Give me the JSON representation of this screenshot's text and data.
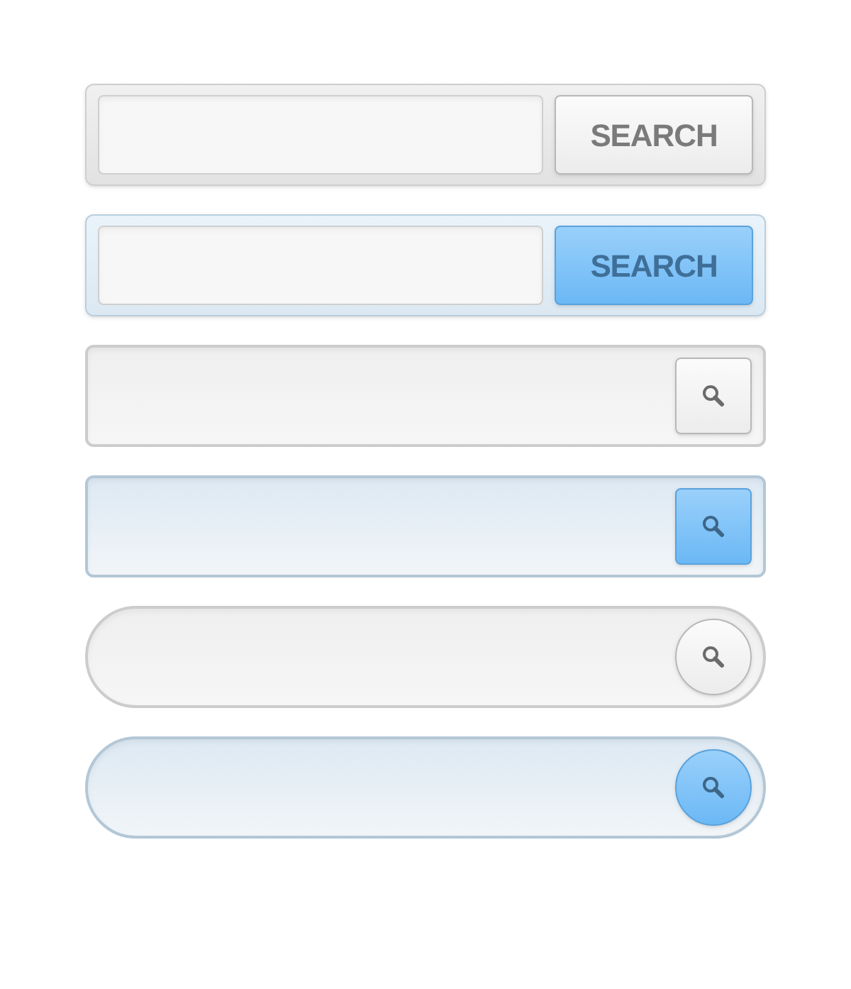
{
  "search_bars": [
    {
      "kind": "text_button",
      "accent": false,
      "button_label": "SEARCH"
    },
    {
      "kind": "text_button",
      "accent": true,
      "button_label": "SEARCH"
    },
    {
      "kind": "icon_button",
      "accent": false
    },
    {
      "kind": "icon_button",
      "accent": true
    },
    {
      "kind": "round",
      "accent": false
    },
    {
      "kind": "round",
      "accent": true
    }
  ]
}
